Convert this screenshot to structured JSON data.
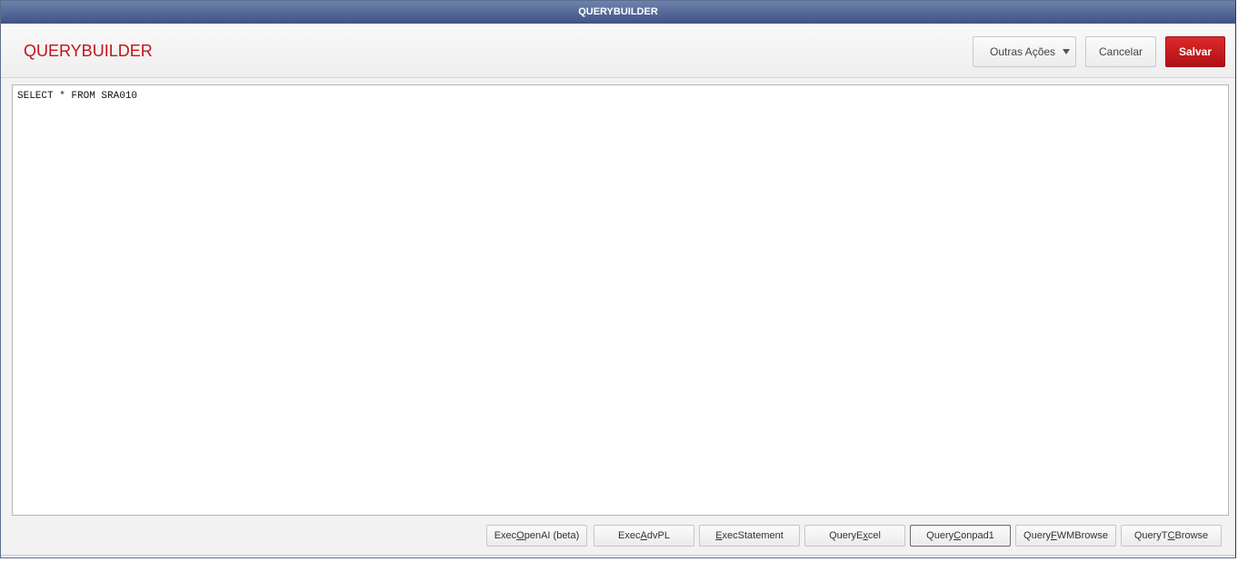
{
  "window": {
    "title": "QUERYBUILDER"
  },
  "header": {
    "title": "QUERYBUILDER",
    "buttons": {
      "outras_acoes": "Outras Ações",
      "cancelar": "Cancelar",
      "salvar": "Salvar"
    }
  },
  "editor": {
    "content": "SELECT * FROM SRA010"
  },
  "footer": {
    "buttons": [
      {
        "pre": "Exec",
        "key": "O",
        "post": "penAI (beta)"
      },
      {
        "pre": "Exec",
        "key": "A",
        "post": "dvPL"
      },
      {
        "pre": "",
        "key": "E",
        "post": "xecStatement"
      },
      {
        "pre": "QueryE",
        "key": "x",
        "post": "cel"
      },
      {
        "pre": "Query",
        "key": "C",
        "post": "onpad1"
      },
      {
        "pre": "Query",
        "key": "F",
        "post": "WMBrowse"
      },
      {
        "pre": "QueryT",
        "key": "C",
        "post": "Browse"
      }
    ]
  },
  "colors": {
    "title_bar": "#3e5384",
    "header_title": "#c0141a",
    "primary_button": "#c9181e"
  }
}
